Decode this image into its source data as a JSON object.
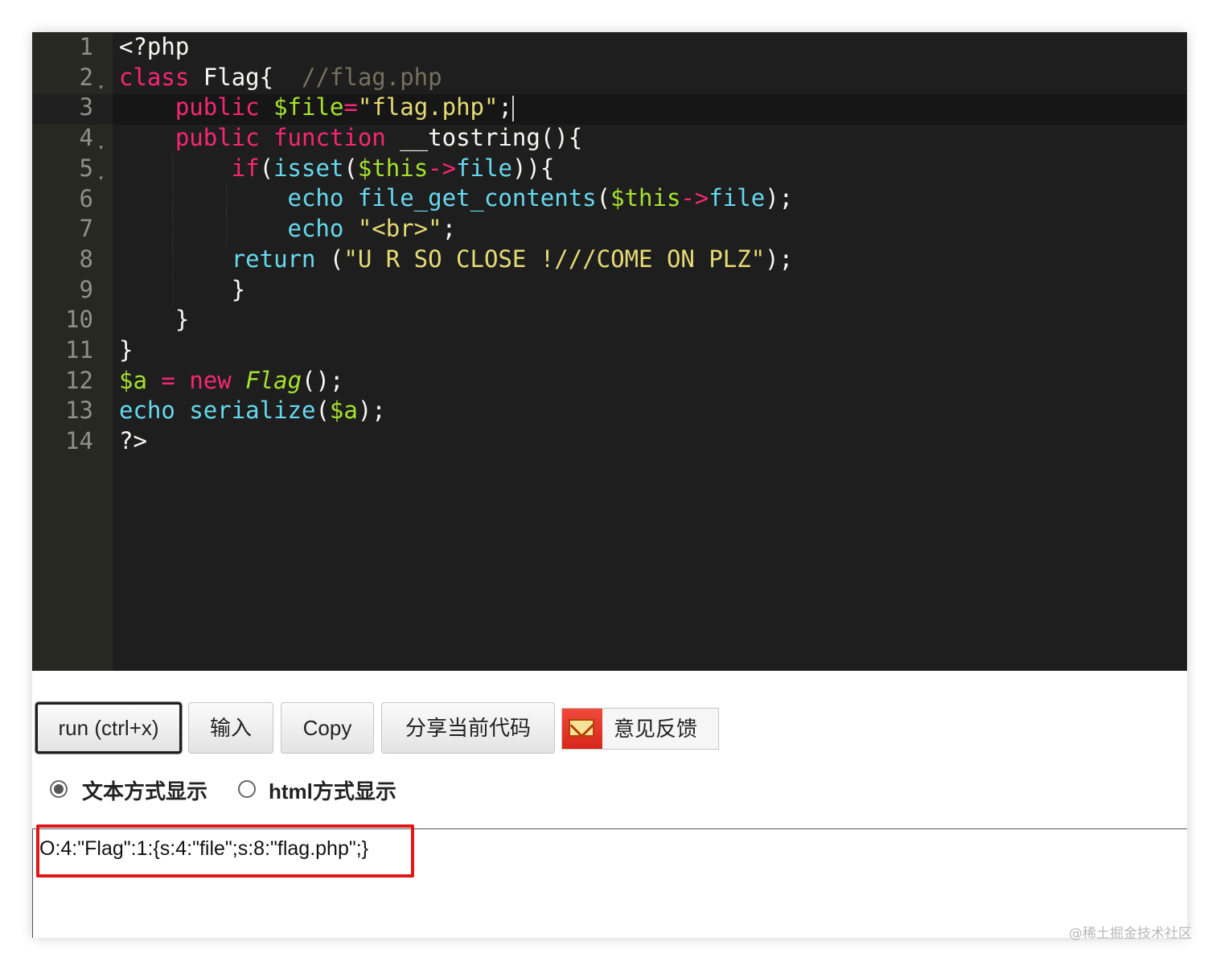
{
  "editor": {
    "lines": [
      {
        "n": "1",
        "segments": [
          {
            "t": "<?php",
            "c": ""
          }
        ]
      },
      {
        "n": "2",
        "fold": true,
        "segments": [
          {
            "t": "class",
            "c": "kw"
          },
          {
            "t": " Flag{  ",
            "c": ""
          },
          {
            "t": "//flag.php",
            "c": "cm"
          }
        ]
      },
      {
        "n": "3",
        "segments": [
          {
            "t": "    ",
            "c": ""
          },
          {
            "t": "public",
            "c": "kw"
          },
          {
            "t": " ",
            "c": ""
          },
          {
            "t": "$file",
            "c": "var"
          },
          {
            "t": "=",
            "c": "kw"
          },
          {
            "t": "\"flag.php\"",
            "c": "str"
          },
          {
            "t": ";",
            "c": ""
          }
        ],
        "cursor": true
      },
      {
        "n": "4",
        "fold": true,
        "segments": [
          {
            "t": "    ",
            "c": ""
          },
          {
            "t": "public",
            "c": "kw"
          },
          {
            "t": " ",
            "c": ""
          },
          {
            "t": "function",
            "c": "kw"
          },
          {
            "t": " __tostring(){",
            "c": ""
          }
        ]
      },
      {
        "n": "5",
        "fold": true,
        "segments": [
          {
            "t": "        ",
            "c": ""
          },
          {
            "t": "if",
            "c": "kw"
          },
          {
            "t": "(",
            "c": ""
          },
          {
            "t": "isset",
            "c": "fn"
          },
          {
            "t": "(",
            "c": ""
          },
          {
            "t": "$this",
            "c": "var"
          },
          {
            "t": "->",
            "c": "kw"
          },
          {
            "t": "file",
            "c": "fn"
          },
          {
            "t": ")){",
            "c": ""
          }
        ]
      },
      {
        "n": "6",
        "segments": [
          {
            "t": "            ",
            "c": ""
          },
          {
            "t": "echo",
            "c": "fn"
          },
          {
            "t": " ",
            "c": ""
          },
          {
            "t": "file_get_contents",
            "c": "fn"
          },
          {
            "t": "(",
            "c": ""
          },
          {
            "t": "$this",
            "c": "var"
          },
          {
            "t": "->",
            "c": "kw"
          },
          {
            "t": "file",
            "c": "fn"
          },
          {
            "t": ");",
            "c": ""
          }
        ]
      },
      {
        "n": "7",
        "segments": [
          {
            "t": "            ",
            "c": ""
          },
          {
            "t": "echo",
            "c": "fn"
          },
          {
            "t": " ",
            "c": ""
          },
          {
            "t": "\"<br>\"",
            "c": "str"
          },
          {
            "t": ";",
            "c": ""
          }
        ]
      },
      {
        "n": "8",
        "segments": [
          {
            "t": "        ",
            "c": ""
          },
          {
            "t": "return",
            "c": "fn"
          },
          {
            "t": " (",
            "c": ""
          },
          {
            "t": "\"U R SO CLOSE !///COME ON PLZ\"",
            "c": "str"
          },
          {
            "t": ");",
            "c": ""
          }
        ]
      },
      {
        "n": "9",
        "segments": [
          {
            "t": "        }",
            "c": ""
          }
        ]
      },
      {
        "n": "10",
        "segments": [
          {
            "t": "    }",
            "c": ""
          }
        ]
      },
      {
        "n": "11",
        "segments": [
          {
            "t": "}",
            "c": ""
          }
        ]
      },
      {
        "n": "12",
        "segments": [
          {
            "t": "$a",
            "c": "var"
          },
          {
            "t": " ",
            "c": ""
          },
          {
            "t": "=",
            "c": "kw"
          },
          {
            "t": " ",
            "c": ""
          },
          {
            "t": "new",
            "c": "kw"
          },
          {
            "t": " ",
            "c": ""
          },
          {
            "t": "Flag",
            "c": "it"
          },
          {
            "t": "();",
            "c": ""
          }
        ]
      },
      {
        "n": "13",
        "segments": [
          {
            "t": "echo",
            "c": "fn"
          },
          {
            "t": " ",
            "c": ""
          },
          {
            "t": "serialize",
            "c": "fn"
          },
          {
            "t": "(",
            "c": ""
          },
          {
            "t": "$a",
            "c": "var"
          },
          {
            "t": ");",
            "c": ""
          }
        ]
      },
      {
        "n": "14",
        "segments": [
          {
            "t": "?>",
            "c": ""
          }
        ]
      }
    ]
  },
  "toolbar": {
    "run_label": "run (ctrl+x)",
    "input_label": "输入",
    "copy_label": "Copy",
    "share_label": "分享当前代码",
    "feedback_label": "意见反馈",
    "feedback_icon": "mail-icon"
  },
  "modes": {
    "text_label": "文本方式显示",
    "html_label": "html方式显示",
    "selected": "text"
  },
  "output": {
    "text": "O:4:\"Flag\":1:{s:4:\"file\";s:8:\"flag.php\";}",
    "highlight_color": "#e01717"
  },
  "watermark": "@稀土掘金技术社区",
  "colors": {
    "editor_bg": "#1e1e1e",
    "gutter_bg": "#272822",
    "keyword": "#f92672",
    "function": "#66d9ef",
    "variable": "#a6e22e",
    "string": "#e6db74",
    "comment": "#75715e"
  }
}
